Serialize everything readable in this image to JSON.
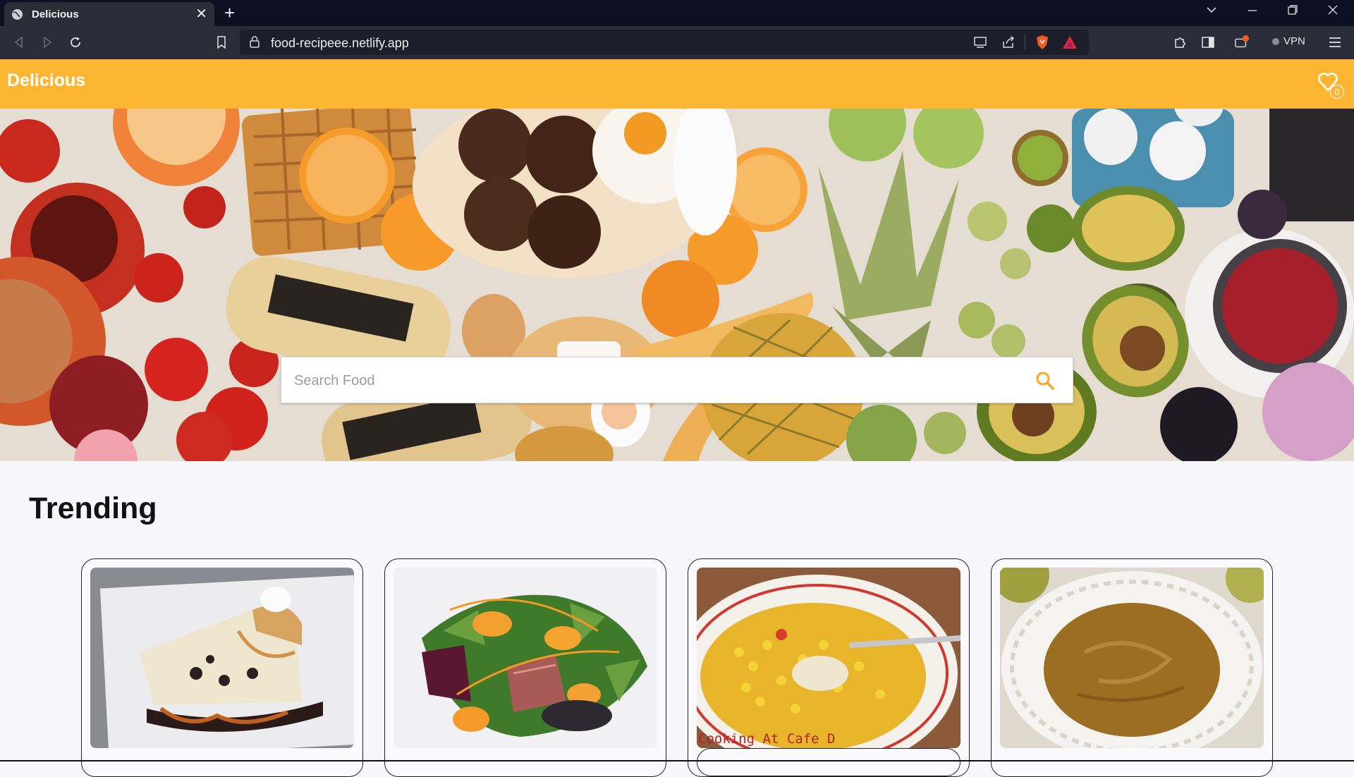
{
  "browser": {
    "tab_title": "Delicious",
    "url": "food-recipeee.netlify.app",
    "vpn_label": "VPN",
    "accent_brave": "#f05a24"
  },
  "site": {
    "brand": "Delicious",
    "header_color": "#fdb631",
    "favorites_count": "0",
    "search_placeholder": "Search Food"
  },
  "trending": {
    "title": "Trending",
    "cards": [
      {
        "photo": "cheesecake-slice"
      },
      {
        "photo": "duck-salad"
      },
      {
        "photo": "corn-chowder",
        "caption": "Cooking At Cafe D"
      },
      {
        "photo": "pureed-soup"
      }
    ]
  }
}
